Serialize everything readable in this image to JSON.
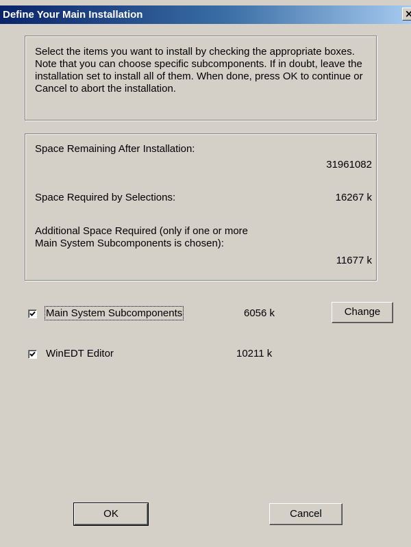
{
  "window": {
    "title": "Define Your Main Installation",
    "close_glyph": "×"
  },
  "instructions": {
    "text": "Select the items you want to install by checking the appropriate boxes. Note that you can choose specific subcomponents. If in doubt, leave the installation set to install all of them. When done, press OK to continue or Cancel to abort the installation."
  },
  "space": {
    "remaining_label": "Space Remaining After Installation:",
    "remaining_value": "31961082",
    "required_label": "Space Required by Selections:",
    "required_value": "16267 k",
    "additional_label_line1": "Additional Space Required (only if one or more",
    "additional_label_line2": "Main System Subcomponents is chosen):",
    "additional_value": "11677 k"
  },
  "components": [
    {
      "label": "Main System Subcomponents",
      "size": "6056 k",
      "checked": true
    },
    {
      "label": "WinEDT Editor",
      "size": "10211 k",
      "checked": true
    }
  ],
  "buttons": {
    "change": "Change",
    "ok": "OK",
    "cancel": "Cancel"
  }
}
